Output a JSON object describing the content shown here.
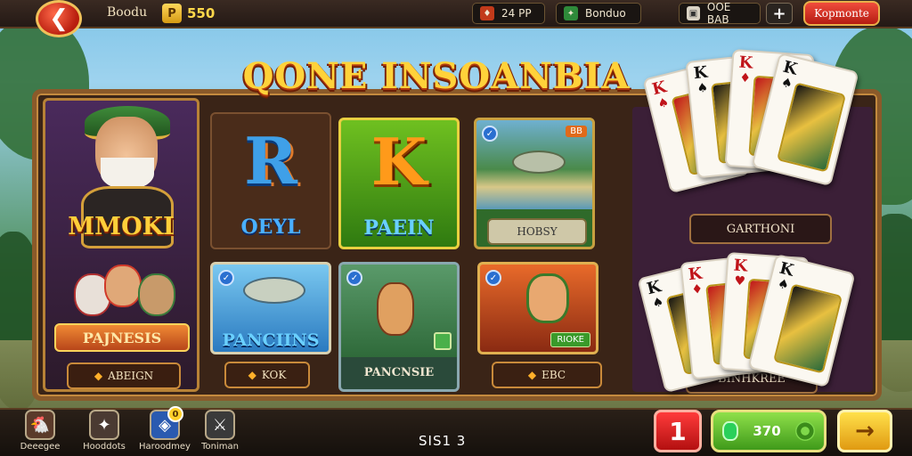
{
  "topbar": {
    "back_icon": "back-arrow-icon",
    "title": "Boodu",
    "coins": {
      "icon_letter": "P",
      "value": "550"
    },
    "pill1": {
      "value": "24 PP"
    },
    "pill2": {
      "value": "Bonduo"
    },
    "pill3": {
      "value": "OOE BAB"
    },
    "plus_label": "+",
    "red_button": "Kopmonte"
  },
  "title": "QONE INSOANBIA",
  "hero": {
    "name": "MMOKI",
    "ribbon": "PAJNESIS",
    "button": "ABEIGN"
  },
  "tiles": {
    "t1": {
      "letter": "R",
      "label": "OEYL"
    },
    "t2": {
      "letter": "K",
      "label": "PAEIN"
    },
    "t3": {
      "tag": "BB",
      "button": "HOBSY"
    },
    "t4": {
      "label": "PANCIINS",
      "button": "KOK"
    },
    "t5": {
      "button": "PANCNSIE"
    },
    "t6": {
      "tag": "RIOKE",
      "button": "EBC"
    }
  },
  "cards": {
    "top": [
      {
        "rank": "K",
        "suit": "♠",
        "color": "#c0141a"
      },
      {
        "rank": "K",
        "suit": "♠",
        "color": "#111111"
      },
      {
        "rank": "K",
        "suit": "♦",
        "color": "#c0141a"
      },
      {
        "rank": "K",
        "suit": "♠",
        "color": "#111111"
      }
    ],
    "top_label": "GARTHONI",
    "bottom": [
      {
        "rank": "K",
        "suit": "♠",
        "color": "#111111"
      },
      {
        "rank": "K",
        "suit": "♦",
        "color": "#c0141a"
      },
      {
        "rank": "K",
        "suit": "♥",
        "color": "#c0141a"
      },
      {
        "rank": "K",
        "suit": "♠",
        "color": "#111111"
      }
    ],
    "bottom_label": "BINHKREE"
  },
  "bottombar": {
    "nav": [
      {
        "label": "Deeegee",
        "icon": "chicken-icon",
        "badge": ""
      },
      {
        "label": "Hooddots",
        "icon": "creature-icon",
        "badge": ""
      },
      {
        "label": "Haroodmey",
        "icon": "shield-icon",
        "badge": "0"
      },
      {
        "label": "Toniman",
        "icon": "sword-icon",
        "badge": ""
      }
    ],
    "center_text": "SIS1 3",
    "red_number": "1",
    "green_value": "370",
    "arrow_label": "→"
  }
}
